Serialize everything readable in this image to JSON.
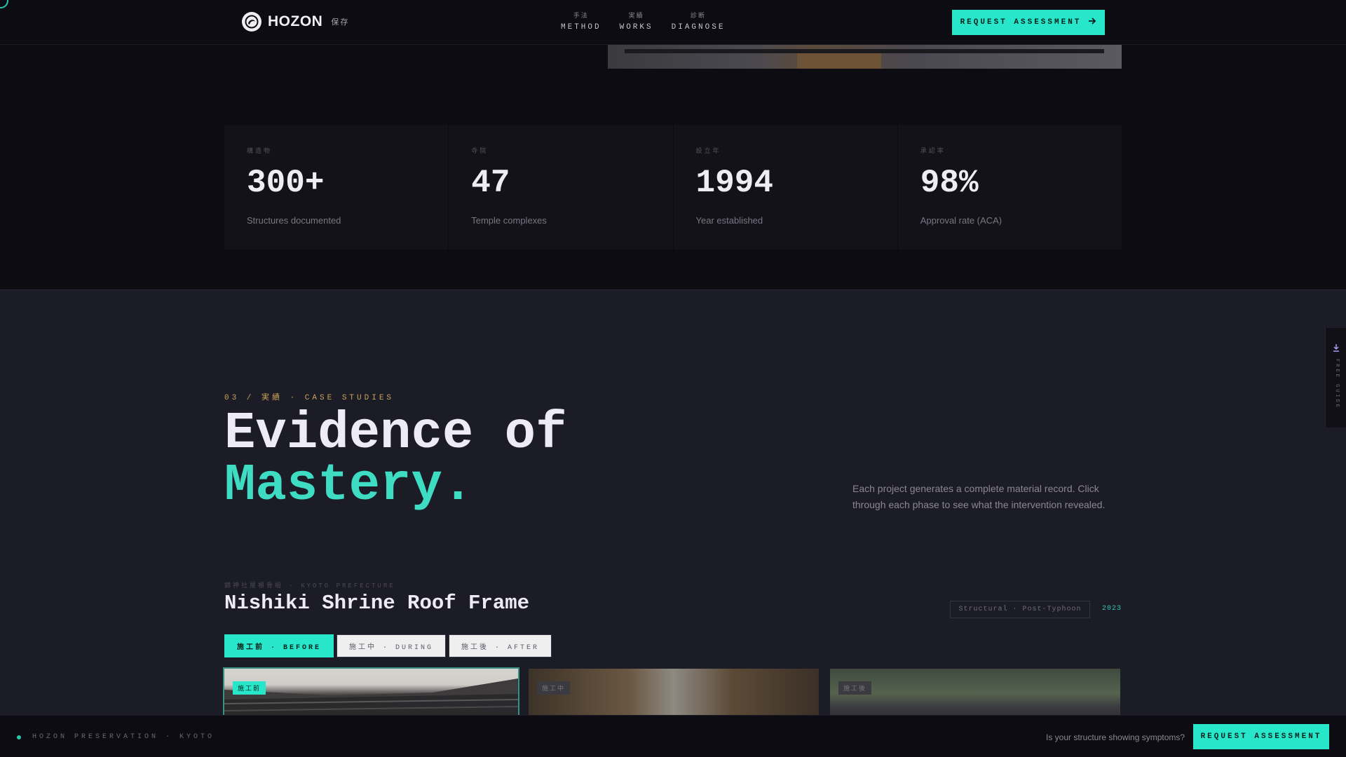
{
  "header": {
    "logo_text": "HOZON",
    "logo_kanji": "保存",
    "nav": [
      {
        "kanji": "手法",
        "label": "METHOD"
      },
      {
        "kanji": "実績",
        "label": "WORKS"
      },
      {
        "kanji": "診断",
        "label": "DIAGNOSE"
      }
    ],
    "cta_label": "REQUEST ASSESSMENT",
    "cta_icon": "arrow-right-icon"
  },
  "stats": [
    {
      "kanji": "構造物",
      "value": "300+",
      "label": "Structures documented"
    },
    {
      "kanji": "寺院",
      "value": "47",
      "label": "Temple complexes"
    },
    {
      "kanji": "設立年",
      "value": "1994",
      "label": "Year established"
    },
    {
      "kanji": "承認率",
      "value": "98%",
      "label": "Approval rate (ACA)"
    }
  ],
  "case_studies": {
    "eyebrow": "03 / 実績 · CASE STUDIES",
    "headline_line1": "Evidence of",
    "headline_line2": "Mastery.",
    "lead": "Each project generates a complete material record. Click through each phase to see what the intervention revealed.",
    "project": {
      "kicker": "錦神社屋根骨組 · KYOTO PREFECTURE",
      "title": "Nishiki Shrine Roof Frame",
      "tag": "Structural · Post-Typhoon",
      "year": "2023",
      "phases": [
        {
          "label": "施工前 · BEFORE",
          "active": true
        },
        {
          "label": "施工中 · DURING",
          "active": false
        },
        {
          "label": "施工後 · AFTER",
          "active": false
        }
      ],
      "thumb_badges": [
        "施工前",
        "施工中",
        "施工後"
      ]
    }
  },
  "side_tab": {
    "label": "FREE GUIDE",
    "icon": "download-icon"
  },
  "footer": {
    "brand": "HOZON PRESERVATION · KYOTO",
    "question": "Is your structure showing symptoms?",
    "cta_label": "REQUEST ASSESSMENT"
  },
  "colors": {
    "accent": "#27e6c9",
    "gold": "#c9a35a",
    "bg": "#0c0c12",
    "section_bg": "#1c1c27"
  }
}
